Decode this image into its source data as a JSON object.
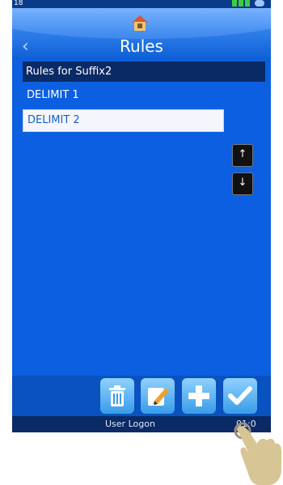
{
  "status_bar": {
    "left_text": "18"
  },
  "header": {
    "title": "Rules",
    "home_icon": "home-icon",
    "back_icon": "chevron-left-icon"
  },
  "list": {
    "header": "Rules for Suffix2",
    "items": [
      {
        "label": "DELIMIT 1",
        "selected": false
      },
      {
        "label": "DELIMIT 2",
        "selected": true
      }
    ]
  },
  "side_buttons": {
    "up_icon": "arrow-up-icon",
    "down_icon": "arrow-down-icon"
  },
  "toolbar": {
    "icons": [
      "trash-icon",
      "edit-icon",
      "plus-icon",
      "checkmark-icon"
    ]
  },
  "footer": {
    "logon_label": "User Logon",
    "time": "01:0"
  },
  "colors": {
    "screen_bg": "#0b5fe0",
    "list_header_bg": "#0a2a66",
    "selected_bg": "#f4f6fb"
  }
}
